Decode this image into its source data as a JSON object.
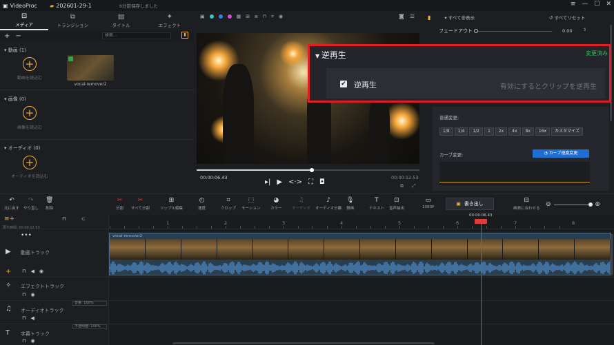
{
  "titlebar": {
    "app_name": "VideoProc",
    "project": "202601-29-1",
    "saved": "6分前保存しました"
  },
  "library": {
    "tabs": [
      {
        "label": "メディア",
        "icon": "media-icon"
      },
      {
        "label": "トランジション",
        "icon": "transition-icon"
      },
      {
        "label": "タイトル",
        "icon": "title-icon"
      },
      {
        "label": "エフェクト",
        "icon": "effect-icon"
      }
    ],
    "search_placeholder": "検索...",
    "video_section": "動画 (1)",
    "video_add": "動画を読込む",
    "clip_name": "vocal-remover2",
    "image_section": "画像 (0)",
    "image_add": "画像を読込む",
    "audio_section": "オーディオ (0)",
    "audio_add": "オーディオを読込む"
  },
  "preview": {
    "current_time": "00:00:06.43",
    "total_time": "00:00:12.53",
    "progress": 0.513
  },
  "right_panel": {
    "show_all": "すべて非表示",
    "reset_all": "すべてリセット",
    "fade_out_label": "フェードアウト",
    "fade_out_value": "0.00",
    "speed_label": "普通変更:",
    "speeds": [
      "1/8",
      "1/4",
      "1/2",
      "1",
      "2x",
      "4x",
      "8x",
      "16x",
      "カスタマイズ"
    ],
    "curve_label": "カーブ変更:",
    "curve_button": "カーブ速度変更"
  },
  "reverse": {
    "title": "逆再生",
    "status": "変更済み",
    "checkbox_label": "逆再生",
    "hint": "有効にするとクリップを逆再生"
  },
  "toolbar": {
    "undo": "元に戻す",
    "redo": "やり直し",
    "delete": "削除",
    "split": "分割",
    "split_all": "すべて分割",
    "ripple": "リップル編集",
    "speed": "速度",
    "crop": "クロップ",
    "motion": "モーション",
    "color": "カラー",
    "audio": "オーディオ",
    "audio_split": "オーディオ分離",
    "record": "録画",
    "text": "テキスト",
    "voice": "音声抽出",
    "resolution": "1080P",
    "export": "書き出し",
    "fit": "画面に合わせる"
  },
  "timeline": {
    "total_label": "再生時間: 00:00:12.53",
    "playhead_time": "00:00:06.43",
    "ruler_ticks": [
      "1",
      "2",
      "3",
      "4",
      "5",
      "6",
      "7",
      "8"
    ],
    "video_track": "動画トラック",
    "clip_name": "vocal-remover2",
    "effect_track": "エフェクトトラック",
    "audio_track": "オーディオトラック",
    "subtitle_track": "字幕トラック",
    "volume_label": "音量: 100%",
    "opacity_label": "不透明度: 100%"
  }
}
